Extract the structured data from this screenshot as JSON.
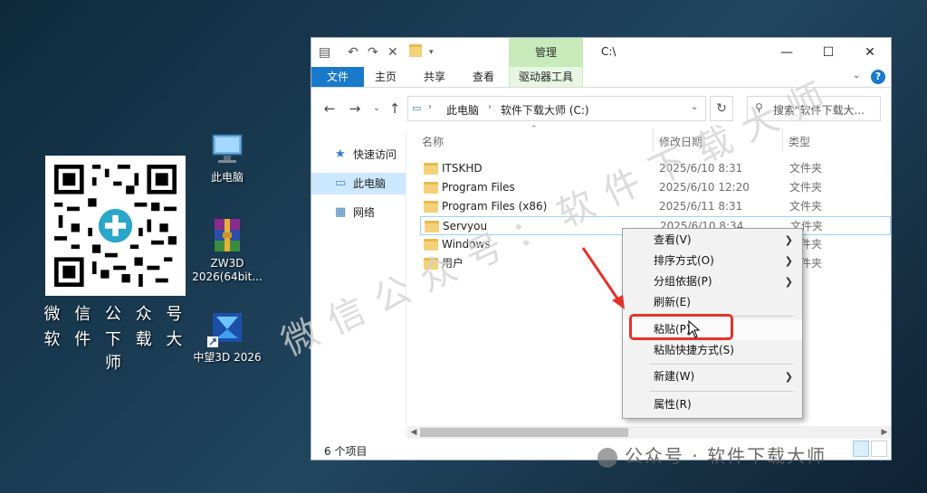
{
  "desktop": {
    "qr_caption_line1": "微 信 公 众 号",
    "qr_caption_line2": "软 件 下 载 大 师",
    "icons": [
      {
        "label": "此电脑"
      },
      {
        "label": "ZW3D 2026(64bit..."
      },
      {
        "label": "中望3D 2026"
      }
    ]
  },
  "window": {
    "title_path": "C:\\",
    "context_tab_header": "管理",
    "ribbon_tabs": [
      "文件",
      "主页",
      "共享",
      "查看",
      "驱动器工具"
    ],
    "help": "?",
    "address": {
      "crumbs": [
        "此电脑",
        "软件下载大师 (C:)"
      ],
      "search_placeholder": "搜索\"软件下载大..."
    },
    "nav": [
      {
        "label": "快速访问"
      },
      {
        "label": "此电脑"
      },
      {
        "label": "网络"
      }
    ],
    "columns": [
      "名称",
      "修改日期",
      "类型"
    ],
    "rows": [
      {
        "name": "ITSKHD",
        "date": "2025/6/10 8:31",
        "type": "文件夹"
      },
      {
        "name": "Program Files",
        "date": "2025/6/10 12:20",
        "type": "文件夹"
      },
      {
        "name": "Program Files (x86)",
        "date": "2025/6/11 8:31",
        "type": "文件夹"
      },
      {
        "name": "Servyou",
        "date": "2025/6/10 8:34",
        "type": "文件夹"
      },
      {
        "name": "Windows",
        "date": "",
        "type": "文件夹"
      },
      {
        "name": "用户",
        "date": "",
        "type": "文件夹"
      }
    ],
    "status": "6 个项目"
  },
  "context_menu": {
    "items": [
      {
        "label": "查看(V)",
        "submenu": true
      },
      {
        "label": "排序方式(O)",
        "submenu": true
      },
      {
        "label": "分组依据(P)",
        "submenu": true
      },
      {
        "label": "刷新(E)",
        "submenu": false
      },
      {
        "label": "粘贴(P)",
        "submenu": false
      },
      {
        "label": "粘贴快捷方式(S)",
        "submenu": false
      },
      {
        "label": "新建(W)",
        "submenu": true
      },
      {
        "label": "属性(R)",
        "submenu": false
      }
    ],
    "highlight_color": "#e5332a"
  },
  "watermark": {
    "diagonal": "微信公众号：软件下载大师",
    "bottom": "公众号 · 软件下载大师"
  },
  "colors": {
    "accent": "#1979ca",
    "context_tab": "#c7ebba",
    "selection": "#cce8ff"
  }
}
